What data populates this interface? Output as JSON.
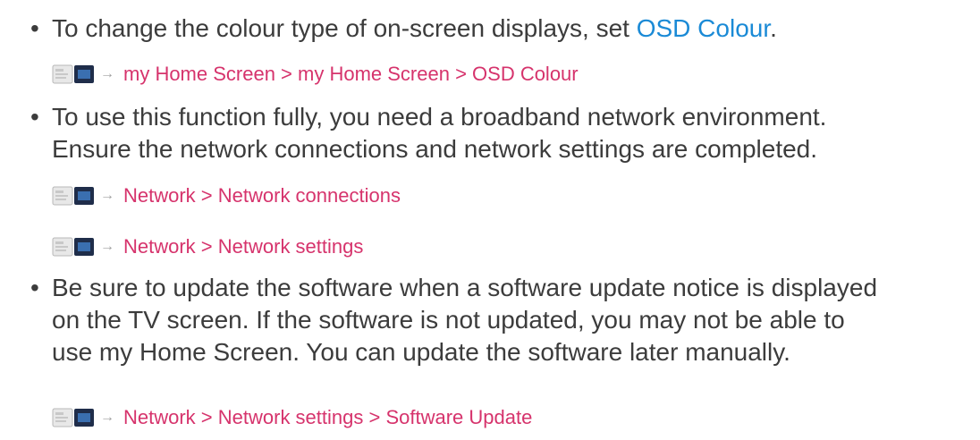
{
  "items": [
    {
      "bullet": "•",
      "lines": [
        {
          "before": "To change the colour type of on-screen displays, set ",
          "link": "OSD Colour",
          "after": "."
        }
      ],
      "refs": [
        "my Home Screen > my Home Screen > OSD Colour"
      ]
    },
    {
      "bullet": "•",
      "lines": [
        "To use this function fully, you need a broadband network environment.",
        "Ensure the network connections and network settings are completed."
      ],
      "refs": [
        "Network > Network connections",
        "Network > Network settings"
      ]
    },
    {
      "bullet": "•",
      "lines": [
        "Be sure to update the software when a software update notice is displayed",
        "on the TV screen. If the software is not updated, you may not be able to",
        "use my Home Screen. You can update the software later manually."
      ],
      "refs": [
        "Network > Network settings > Software Update"
      ]
    }
  ],
  "icons": {
    "reference": "eHelp-book-icon",
    "arrow": "arrow-right-icon"
  },
  "colors": {
    "text": "#3c3c3c",
    "link": "#1a8ad6",
    "reference": "#d6336c",
    "arrow": "#a0a0a0"
  }
}
